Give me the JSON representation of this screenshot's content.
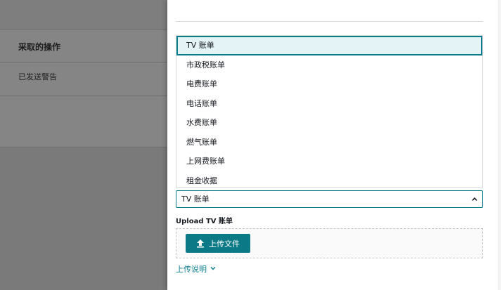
{
  "background": {
    "section_title": "采取的操作",
    "row_text": "已发送警告"
  },
  "dropdown": {
    "options": [
      "TV 账单",
      "市政税账单",
      "电费账单",
      "电话账单",
      "水费账单",
      "燃气账单",
      "上网费账单",
      "租金收据"
    ],
    "selected_index": 0
  },
  "select": {
    "value": "TV 账单",
    "chevron_icon": "chevron-up-icon"
  },
  "upload": {
    "label": "Upload TV 账单",
    "button_label": "上传文件",
    "button_icon": "upload-icon"
  },
  "instructions": {
    "label": "上传说明",
    "icon": "chevron-down-icon"
  },
  "colors": {
    "accent": "#0a7d8c",
    "button": "#0b7986",
    "selected_bg": "#e4f3f5"
  }
}
